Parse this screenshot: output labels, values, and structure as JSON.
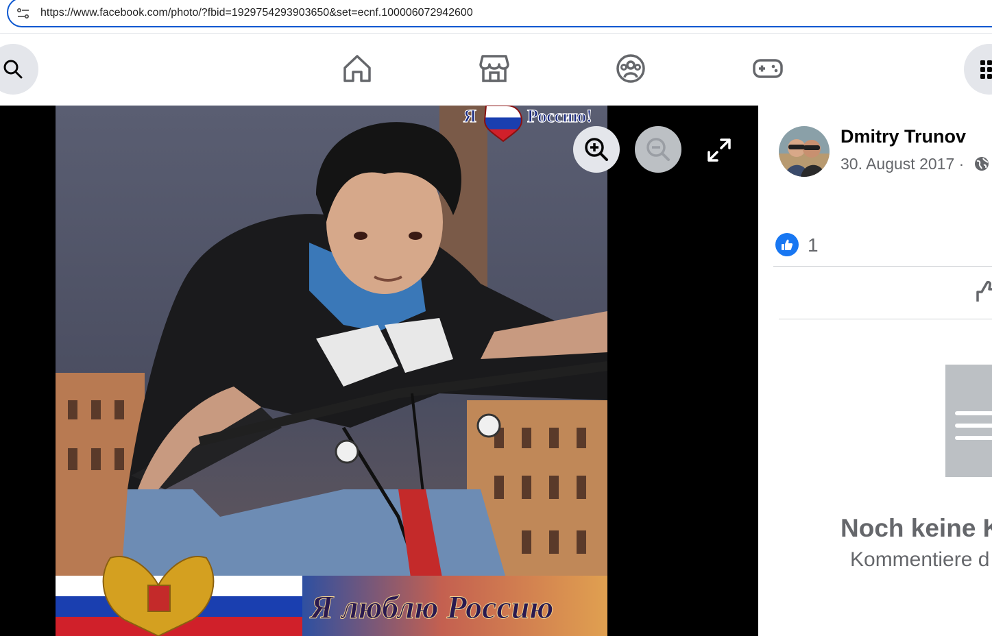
{
  "browser": {
    "url": "https://www.facebook.com/photo/?fbid=1929754293903650&set=ecnf.100006072942600"
  },
  "nav": {
    "icons": [
      "search-icon",
      "home-icon",
      "marketplace-icon",
      "groups-icon",
      "gaming-icon",
      "menu-grid-icon"
    ]
  },
  "photo": {
    "caption_top": "Я ❤ Россию!",
    "banner_text": "Я люблю Россию",
    "controls": [
      "zoom-in-icon",
      "zoom-out-icon",
      "fullscreen-icon"
    ]
  },
  "post": {
    "author": "Dmitry Trunov",
    "date": "30. August 2017 ·",
    "like_count": "1"
  },
  "comments": {
    "empty_title": "Noch keine K",
    "empty_subtitle": "Kommentiere d"
  },
  "colors": {
    "accent": "#1877f2",
    "url_border": "#0b57d0",
    "secondary_text": "#65676b",
    "nav_icon": "#65676b"
  }
}
